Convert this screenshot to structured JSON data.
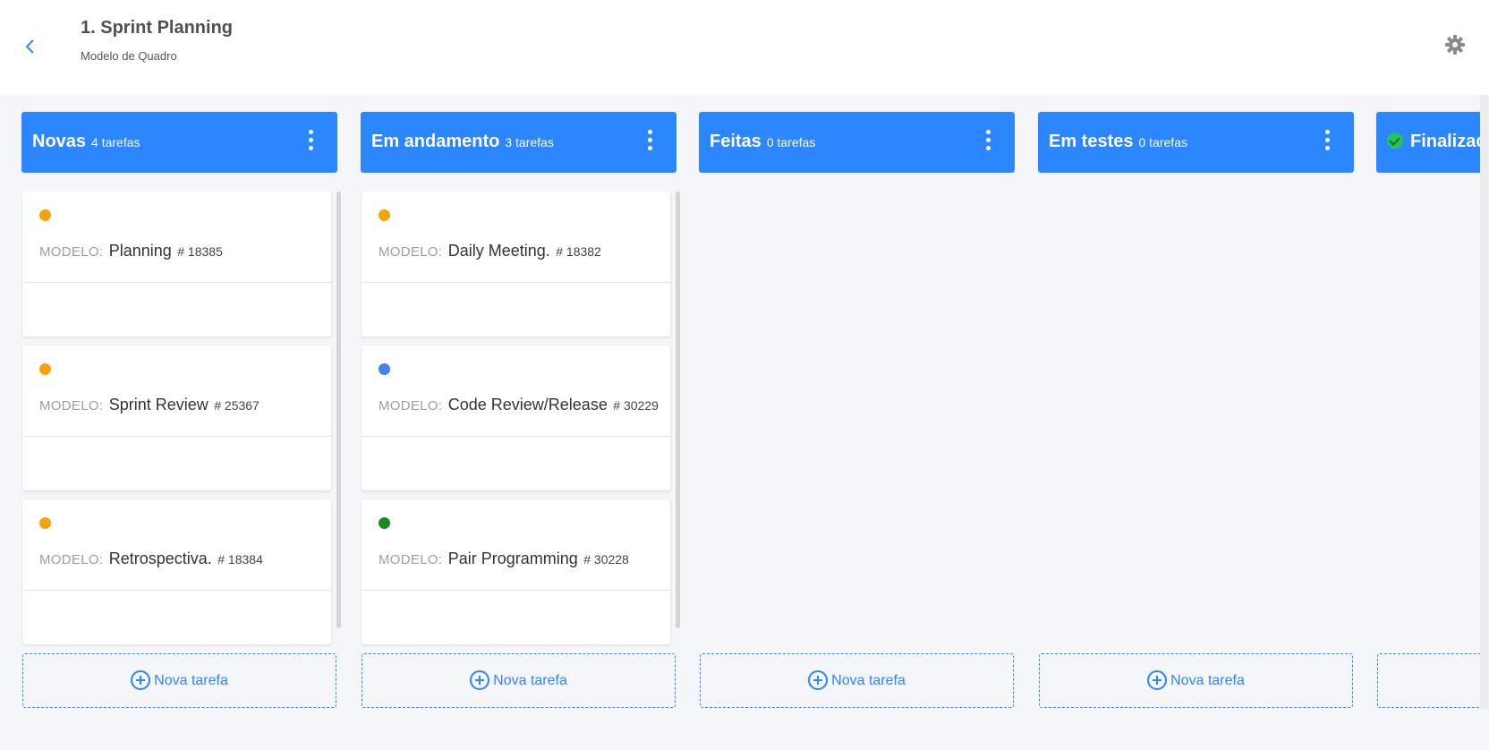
{
  "header": {
    "title": "1. Sprint Planning",
    "subtitle": "Modelo de Quadro",
    "back_icon": "chevron-left-icon",
    "settings_icon": "gear-icon"
  },
  "colors": {
    "accent": "#2b86ff",
    "dot_orange": "#f5a30a",
    "dot_blue": "#4a7ef0",
    "dot_green": "#1a8a1a",
    "done_check": "#22c55e"
  },
  "columns": [
    {
      "title": "Novas",
      "count": "4 tarefas",
      "new_task": "Nova tarefa",
      "cards": [
        {
          "prefix": "MODELO:",
          "name": "Planning",
          "id": "# 18385",
          "dot": "#f5a30a"
        },
        {
          "prefix": "MODELO:",
          "name": "Sprint Review",
          "id": "# 25367",
          "dot": "#f5a30a"
        },
        {
          "prefix": "MODELO:",
          "name": "Retrospectiva.",
          "id": "# 18384",
          "dot": "#f5a30a"
        }
      ]
    },
    {
      "title": "Em andamento",
      "count": "3 tarefas",
      "new_task": "Nova tarefa",
      "cards": [
        {
          "prefix": "MODELO:",
          "name": "Daily Meeting.",
          "id": "# 18382",
          "dot": "#f5a30a"
        },
        {
          "prefix": "MODELO:",
          "name": "Code Review/Release",
          "id": "# 30229",
          "dot": "#4a7ef0"
        },
        {
          "prefix": "MODELO:",
          "name": "Pair Programming",
          "id": "# 30228",
          "dot": "#1a8a1a"
        }
      ]
    },
    {
      "title": "Feitas",
      "count": "0 tarefas",
      "new_task": "Nova tarefa",
      "cards": []
    },
    {
      "title": "Em testes",
      "count": "0 tarefas",
      "new_task": "Nova tarefa",
      "cards": []
    },
    {
      "title": "Finalizad",
      "count": "",
      "new_task": "",
      "cards": []
    }
  ]
}
